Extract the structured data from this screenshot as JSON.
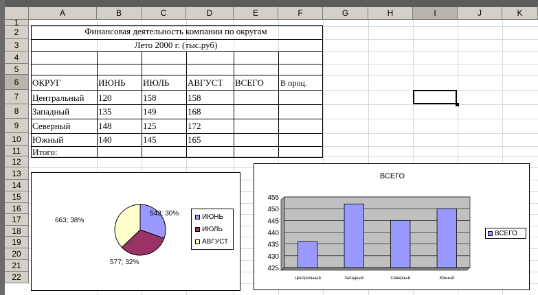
{
  "columns": [
    "A",
    "B",
    "C",
    "D",
    "E",
    "F",
    "G",
    "H",
    "I",
    "J",
    "K"
  ],
  "rows": [
    "1",
    "2",
    "3",
    "4",
    "5",
    "6",
    "7",
    "8",
    "9",
    "10",
    "11",
    "12",
    "13",
    "14",
    "15",
    "16",
    "17",
    "18",
    "19",
    "20",
    "21",
    "22"
  ],
  "sheet": {
    "title": "Финансовая деятельность компании по округам",
    "subtitle": "Лето 2000 г. (тыс.руб)",
    "headers": [
      "ОКРУГ",
      "ИЮНЬ",
      "ИЮЛЬ",
      "АВГУСТ",
      "ВСЕГО",
      "В проц."
    ],
    "data": [
      [
        "Центральный",
        "120",
        "158",
        "158"
      ],
      [
        "Западный",
        "135",
        "149",
        "168"
      ],
      [
        "Северный",
        "148",
        "125",
        "172"
      ],
      [
        "Южный",
        "140",
        "145",
        "165"
      ]
    ],
    "total_label": "Итого:"
  },
  "chart_data": [
    {
      "type": "pie",
      "labels": [
        "ИЮНЬ",
        "ИЮЛЬ",
        "АВГУСТ"
      ],
      "values": [
        543,
        577,
        663
      ],
      "percents": [
        "30%",
        "32%",
        "38%"
      ],
      "data_labels": [
        "543; 30%",
        "577; 32%",
        "663; 38%"
      ],
      "colors": [
        "#9999ff",
        "#993366",
        "#ffffcc"
      ],
      "legend": "right"
    },
    {
      "type": "bar",
      "title": "ВСЕГО",
      "categories": [
        "Центральный",
        "Западный",
        "Северный",
        "Южный"
      ],
      "series": [
        {
          "name": "ВСЕГО",
          "values": [
            436,
            452,
            445,
            450
          ]
        }
      ],
      "ylim": [
        425,
        455
      ],
      "yticks": [
        "425",
        "430",
        "435",
        "440",
        "445",
        "450",
        "455"
      ],
      "grid": true,
      "legend": "right",
      "colors": {
        "bar": "#9999ff",
        "plot_bg": "#c0c0c0"
      }
    }
  ]
}
